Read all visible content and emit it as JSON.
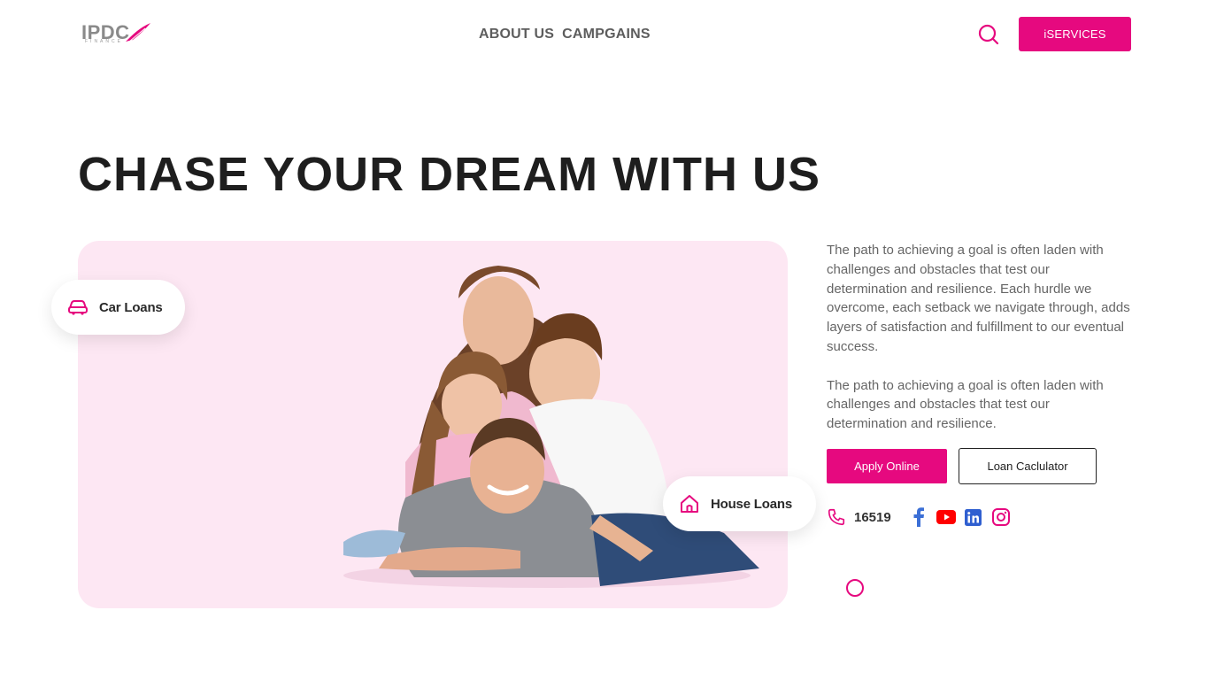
{
  "brand": {
    "logo_text": "IPDC",
    "logo_sub": "FINANCE",
    "accent_color": "#e6097f"
  },
  "nav": {
    "items": [
      {
        "label": "ABOUT US"
      },
      {
        "label": "CAMPGAINS"
      }
    ]
  },
  "header": {
    "search_icon": "search-icon",
    "iservices_label": "iSERVICES"
  },
  "hero": {
    "title": "CHASE YOUR DREAM WITH US",
    "panel_color": "#fde7f3",
    "chips": [
      {
        "label": "Car Loans",
        "icon": "car-icon"
      },
      {
        "label": "House Loans",
        "icon": "house-icon"
      }
    ]
  },
  "copy": {
    "paragraphs": [
      "The path to achieving a goal is often laden with challenges and obstacles that test our determination and resilience. Each hurdle we overcome, each setback we navigate through, adds layers of satisfaction and fulfillment to our eventual success.",
      "The path to achieving a goal is often laden with challenges and obstacles that test our determination and resilience."
    ]
  },
  "actions": {
    "apply_label": "Apply Online",
    "calculator_label": "Loan Caclulator"
  },
  "contact": {
    "phone": "16519",
    "socials": [
      {
        "icon": "facebook-icon",
        "color": "#3b6fd6"
      },
      {
        "icon": "youtube-icon",
        "color": "#ff0000"
      },
      {
        "icon": "linkedin-icon",
        "color": "#2f5fd0"
      },
      {
        "icon": "instagram-icon",
        "color": "#e6097f"
      }
    ]
  }
}
